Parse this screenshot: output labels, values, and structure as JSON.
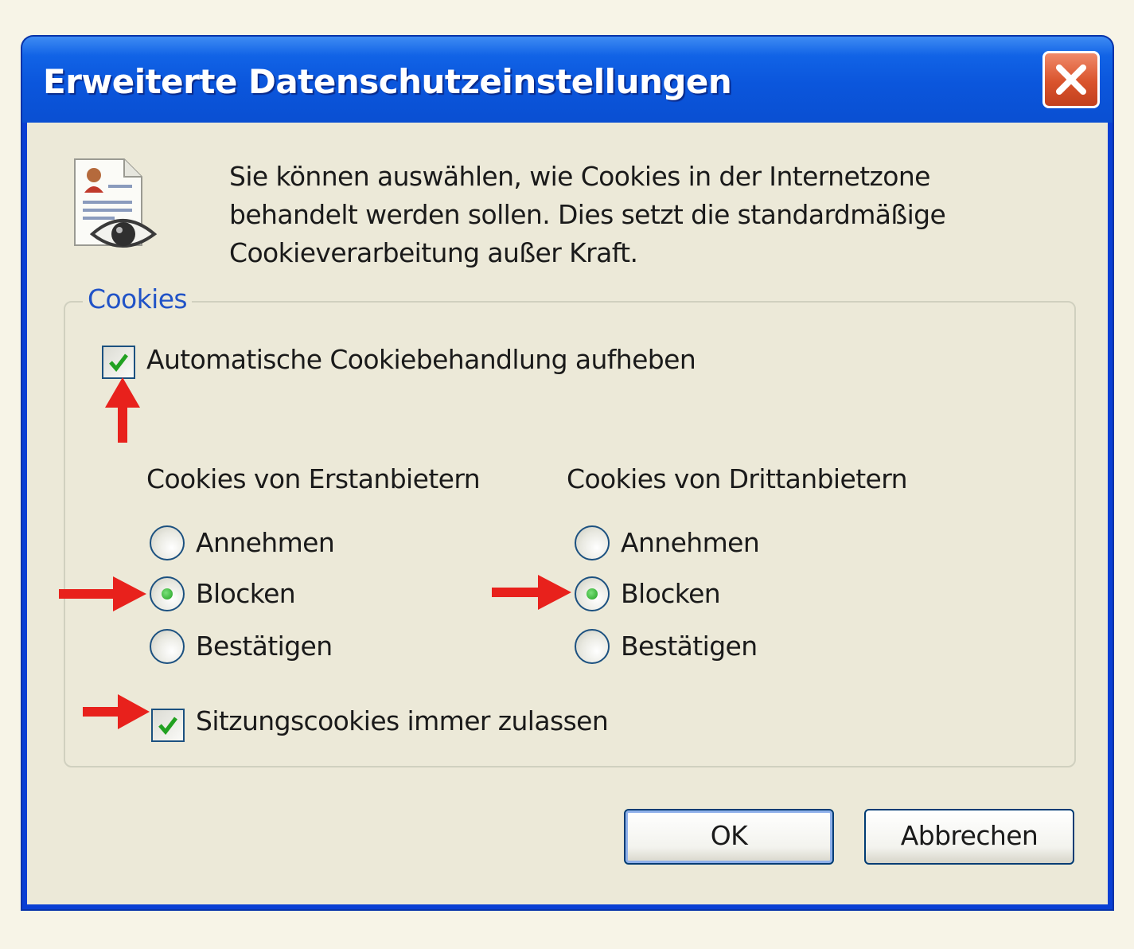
{
  "window": {
    "title": "Erweiterte Datenschutzeinstellungen",
    "close_icon": "close-x-icon"
  },
  "intro": {
    "icon": "privacy-document-eye-icon",
    "line1": "Sie können auswählen, wie Cookies in der Internetzone",
    "line2": "behandelt werden sollen. Dies setzt die standardmäßige",
    "line3": "Cookieverarbeitung außer Kraft."
  },
  "cookies_group": {
    "legend": "Cookies",
    "override_automatic": {
      "label": "Automatische Cookiebehandlung aufheben",
      "checked": true
    },
    "first_party": {
      "heading": "Cookies von Erstanbietern",
      "options": [
        "Annehmen",
        "Blocken",
        "Bestätigen"
      ],
      "selected": "Blocken"
    },
    "third_party": {
      "heading": "Cookies von Drittanbietern",
      "options": [
        "Annehmen",
        "Blocken",
        "Bestätigen"
      ],
      "selected": "Blocken"
    },
    "session_cookies": {
      "label": "Sitzungscookies immer zulassen",
      "checked": true
    }
  },
  "buttons": {
    "ok": "OK",
    "cancel": "Abbrechen"
  },
  "colors": {
    "title_bar": "#0a56dc",
    "dialog_background": "#ece9d8",
    "legend_text": "#2153c7",
    "annotation_arrow": "#e8211c",
    "checkmark": "#21a121"
  }
}
